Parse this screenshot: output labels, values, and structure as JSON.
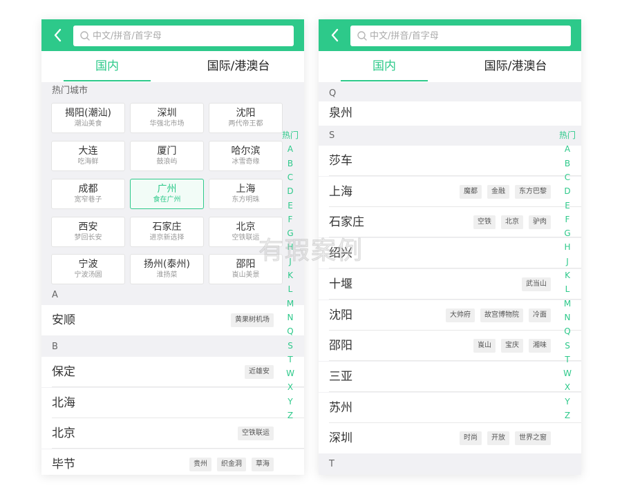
{
  "colors": {
    "accent": "#2dc98a",
    "background": "#f1f1f4",
    "tag_bg": "#efefef"
  },
  "left": {
    "search": {
      "placeholder": "中文/拼音/首字母"
    },
    "tabs": [
      "国内",
      "国际/港澳台"
    ],
    "hot_title": "热门城市",
    "hot_cities": [
      {
        "name": "揭阳(潮汕)",
        "sub": "潮汕美食"
      },
      {
        "name": "深圳",
        "sub": "华强北市场"
      },
      {
        "name": "沈阳",
        "sub": "两代帝王都"
      },
      {
        "name": "大连",
        "sub": "吃海鲜"
      },
      {
        "name": "厦门",
        "sub": "鼓浪屿"
      },
      {
        "name": "哈尔滨",
        "sub": "冰雪奇缘"
      },
      {
        "name": "成都",
        "sub": "宽窄巷子"
      },
      {
        "name": "广州",
        "sub": "食在广州"
      },
      {
        "name": "上海",
        "sub": "东方明珠"
      },
      {
        "name": "西安",
        "sub": "梦回长安"
      },
      {
        "name": "石家庄",
        "sub": "进京新选择"
      },
      {
        "name": "北京",
        "sub": "空铁联运"
      },
      {
        "name": "宁波",
        "sub": "宁波汤圆"
      },
      {
        "name": "扬州(泰州)",
        "sub": "淮扬菜"
      },
      {
        "name": "邵阳",
        "sub": "崀山美景"
      }
    ],
    "selected_hot_city": "广州",
    "sections": [
      {
        "letter": "A",
        "rows": [
          {
            "city": "安顺",
            "tags": [
              "黄果树机场"
            ]
          }
        ]
      },
      {
        "letter": "B",
        "rows": [
          {
            "city": "保定",
            "tags": [
              "近雄安"
            ]
          },
          {
            "city": "北海",
            "tags": []
          },
          {
            "city": "北京",
            "tags": [
              "空铁联运"
            ]
          },
          {
            "city": "毕节",
            "tags": [
              "贵州",
              "织金洞",
              "草海"
            ]
          }
        ]
      }
    ],
    "index_letters": [
      "热门",
      "A",
      "B",
      "C",
      "D",
      "E",
      "F",
      "G",
      "H",
      "J",
      "K",
      "L",
      "M",
      "N",
      "Q",
      "S",
      "T",
      "W",
      "X",
      "Y",
      "Z"
    ]
  },
  "right": {
    "search": {
      "placeholder": "中文/拼音/首字母"
    },
    "tabs": [
      "国内",
      "国际/港澳台"
    ],
    "sections": [
      {
        "letter": "Q",
        "rows": [
          {
            "city": "泉州",
            "tags": []
          }
        ]
      },
      {
        "letter": "S",
        "rows": [
          {
            "city": "莎车",
            "tags": []
          },
          {
            "city": "上海",
            "tags": [
              "魔都",
              "金融",
              "东方巴黎"
            ]
          },
          {
            "city": "石家庄",
            "tags": [
              "空铁",
              "北京",
              "驴肉"
            ]
          },
          {
            "city": "绍兴",
            "tags": []
          },
          {
            "city": "十堰",
            "tags": [
              "武当山"
            ]
          },
          {
            "city": "沈阳",
            "tags": [
              "大帅府",
              "故宫博物院",
              "冷面"
            ]
          },
          {
            "city": "邵阳",
            "tags": [
              "崀山",
              "宝庆",
              "湘味"
            ]
          },
          {
            "city": "三亚",
            "tags": []
          },
          {
            "city": "苏州",
            "tags": []
          },
          {
            "city": "深圳",
            "tags": [
              "时尚",
              "开放",
              "世界之窗"
            ]
          }
        ]
      },
      {
        "letter": "T",
        "rows": []
      }
    ],
    "index_letters": [
      "热门",
      "A",
      "B",
      "C",
      "D",
      "E",
      "F",
      "G",
      "H",
      "J",
      "K",
      "L",
      "M",
      "N",
      "Q",
      "S",
      "T",
      "W",
      "X",
      "Y",
      "Z"
    ]
  },
  "watermark": "有瑕案例"
}
